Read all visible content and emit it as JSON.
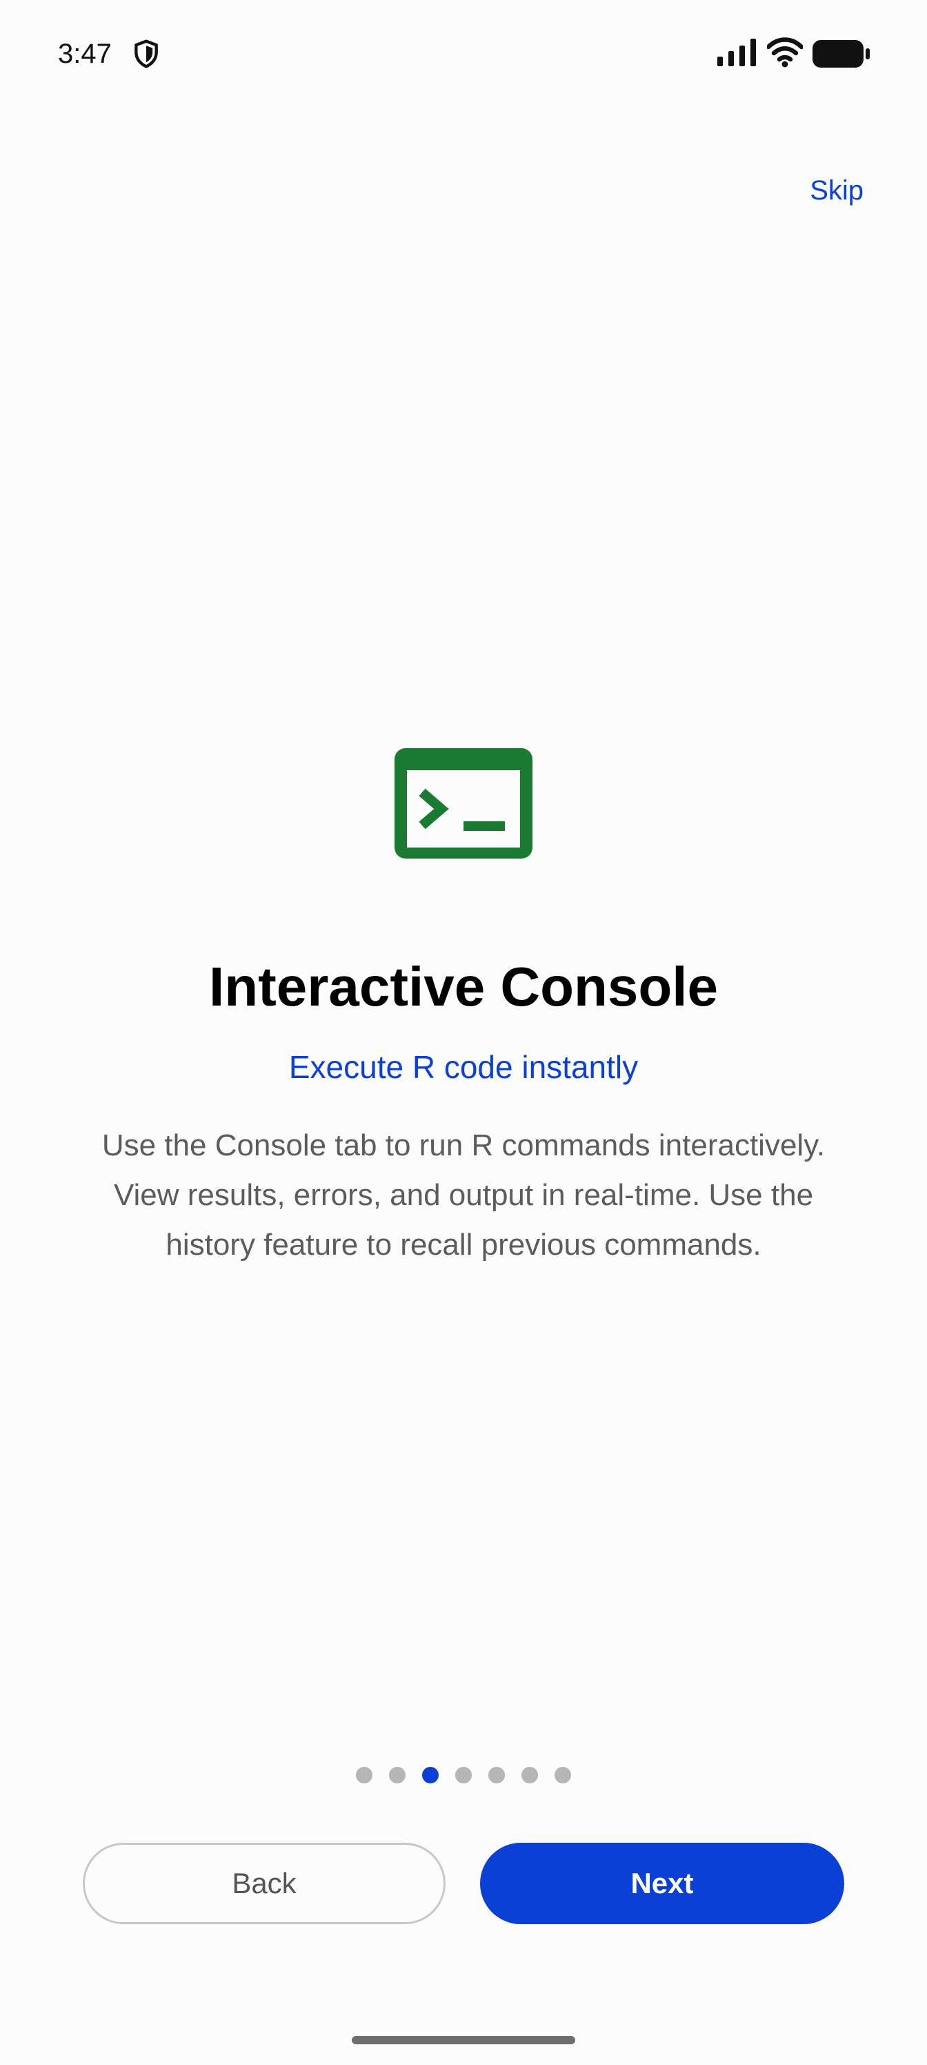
{
  "status_bar": {
    "time": "3:47",
    "icons": [
      "shield-icon",
      "signal-icon",
      "wifi-icon",
      "battery-icon"
    ]
  },
  "header": {
    "skip_label": "Skip"
  },
  "slide": {
    "icon": "console-icon",
    "title": "Interactive Console",
    "subtitle": "Execute R code instantly",
    "description": "Use the Console tab to run R commands interactively. View results, errors, and output in real-time. Use the history feature to recall previous commands."
  },
  "pager": {
    "total": 7,
    "current": 3
  },
  "footer": {
    "back_label": "Back",
    "next_label": "Next"
  },
  "colors": {
    "accent": "#0a40d6",
    "icon_green": "#1b7a32",
    "background": "#fcfcfc",
    "body_text": "#5c5c5c",
    "dot_inactive": "#b5b5b5"
  }
}
